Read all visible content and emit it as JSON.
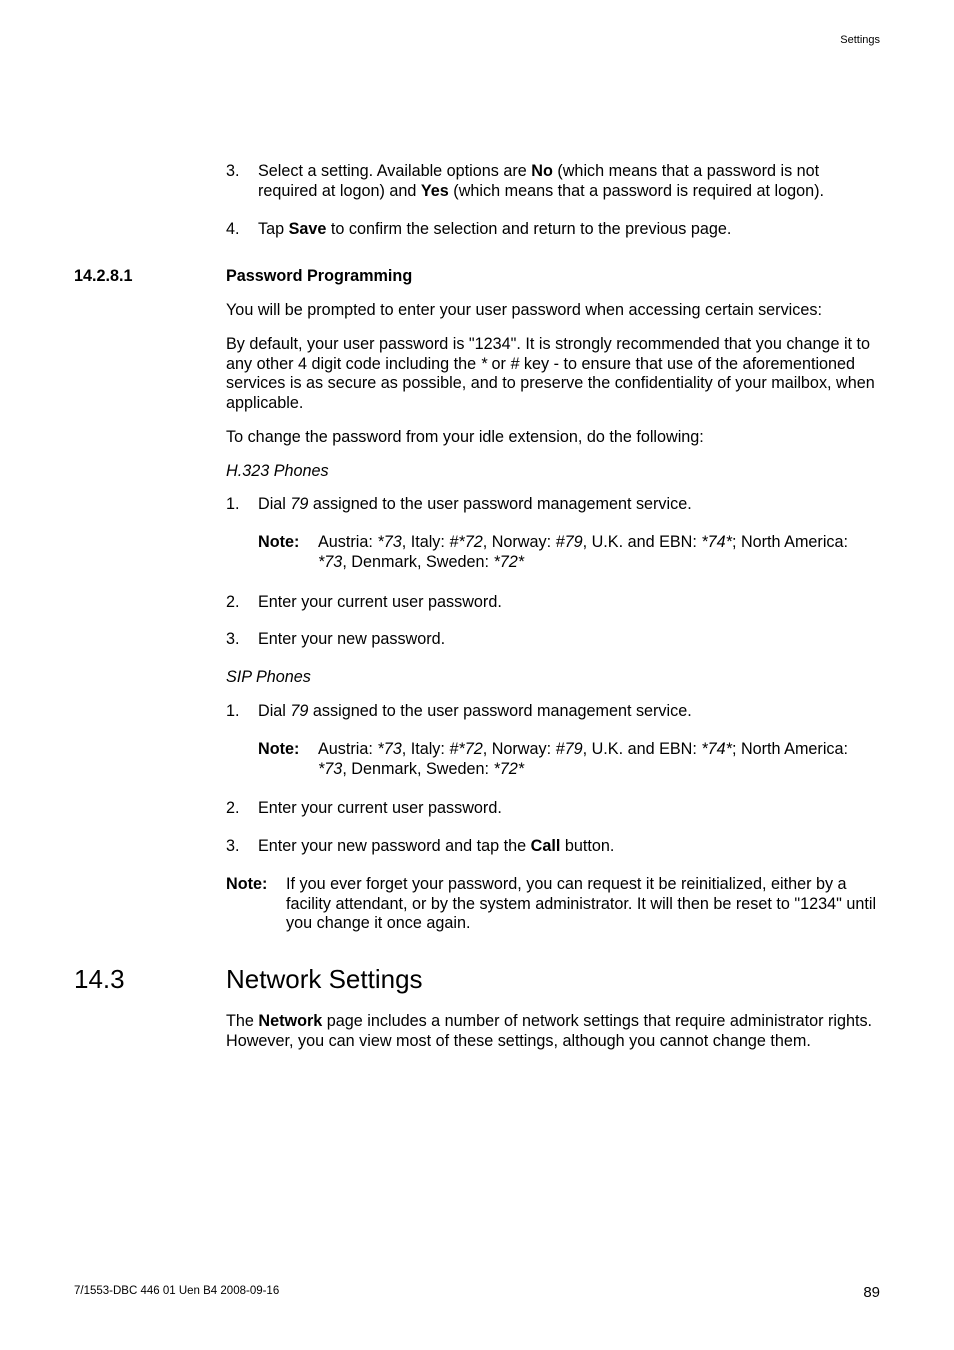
{
  "header": {
    "right": "Settings"
  },
  "steps_a": [
    {
      "n": "3.",
      "pre": "Select a setting. Available options are ",
      "b1": "No",
      "mid": " (which means that a password is not required at logon) and ",
      "b2": "Yes",
      "post": " (which means that a password is required at logon)."
    },
    {
      "n": "4.",
      "pre": "Tap ",
      "b1": "Save",
      "post": " to confirm the selection and return to the previous page."
    }
  ],
  "sec1": {
    "num": "14.2.8.1",
    "title": "Password Programming"
  },
  "p1": "You will be prompted to enter your user password when accessing certain services:",
  "p2": {
    "a": "By default, your user password is \"1234\". It is strongly recommended that you change it to any other 4 digit code including the ",
    "i1": "*",
    "b": " or ",
    "i2": "#",
    "c": " key - to ensure that use of the aforementioned services is as secure as possible, and to preserve the confidentiality of your mailbox, when applicable."
  },
  "p3": "To change the password from your idle extension, do the following:",
  "sub1": "H.323 Phones",
  "h323": {
    "s1": {
      "n": "1.",
      "a": "Dial ",
      "i": "79",
      "b": " assigned to the user password management service."
    },
    "note": {
      "label": "Note:",
      "a": "Austria: ",
      "i1": "*73",
      "b": ", Italy: ",
      "i2": "#*72",
      "c": ", Norway: ",
      "i3": "#79",
      "d": ", U.K. and EBN: ",
      "i4": "*74*",
      "e": "; North America: ",
      "i5": "*73",
      "f": ", Denmark, Sweden: ",
      "i6": "*72*"
    },
    "s2": {
      "n": "2.",
      "t": "Enter your current user password."
    },
    "s3": {
      "n": "3.",
      "t": "Enter your new password."
    }
  },
  "sub2": "SIP Phones",
  "sip": {
    "s1": {
      "n": "1.",
      "a": "Dial ",
      "i": "79",
      "b": " assigned to the user password management service."
    },
    "note": {
      "label": "Note:",
      "a": "Austria: ",
      "i1": "*73",
      "b": ", Italy: ",
      "i2": "#*72",
      "c": ", Norway: ",
      "i3": "#79",
      "d": ", U.K. and EBN: ",
      "i4": "*74*",
      "e": "; North America: ",
      "i5": "*73",
      "f": ", Denmark, Sweden: ",
      "i6": "*72*"
    },
    "s2": {
      "n": "2.",
      "t": "Enter your current user password."
    },
    "s3": {
      "n": "3.",
      "a": "Enter your new password and tap the ",
      "b": "Call",
      "c": " button."
    }
  },
  "note_final": {
    "label": "Note:",
    "t": "If you ever forget your password, you can request it be reinitialized, either by a facility attendant, or by the system administrator. It will then be reset to \"1234\" until you change it once again."
  },
  "sec2": {
    "num": "14.3",
    "title": "Network Settings"
  },
  "p4": {
    "a": "The ",
    "b": "Network",
    "c": " page includes a number of network settings that require administrator rights. However, you can view most of these settings, although you cannot change them."
  },
  "footer": {
    "left": "7/1553-DBC 446 01 Uen B4  2008-09-16",
    "right": "89"
  }
}
